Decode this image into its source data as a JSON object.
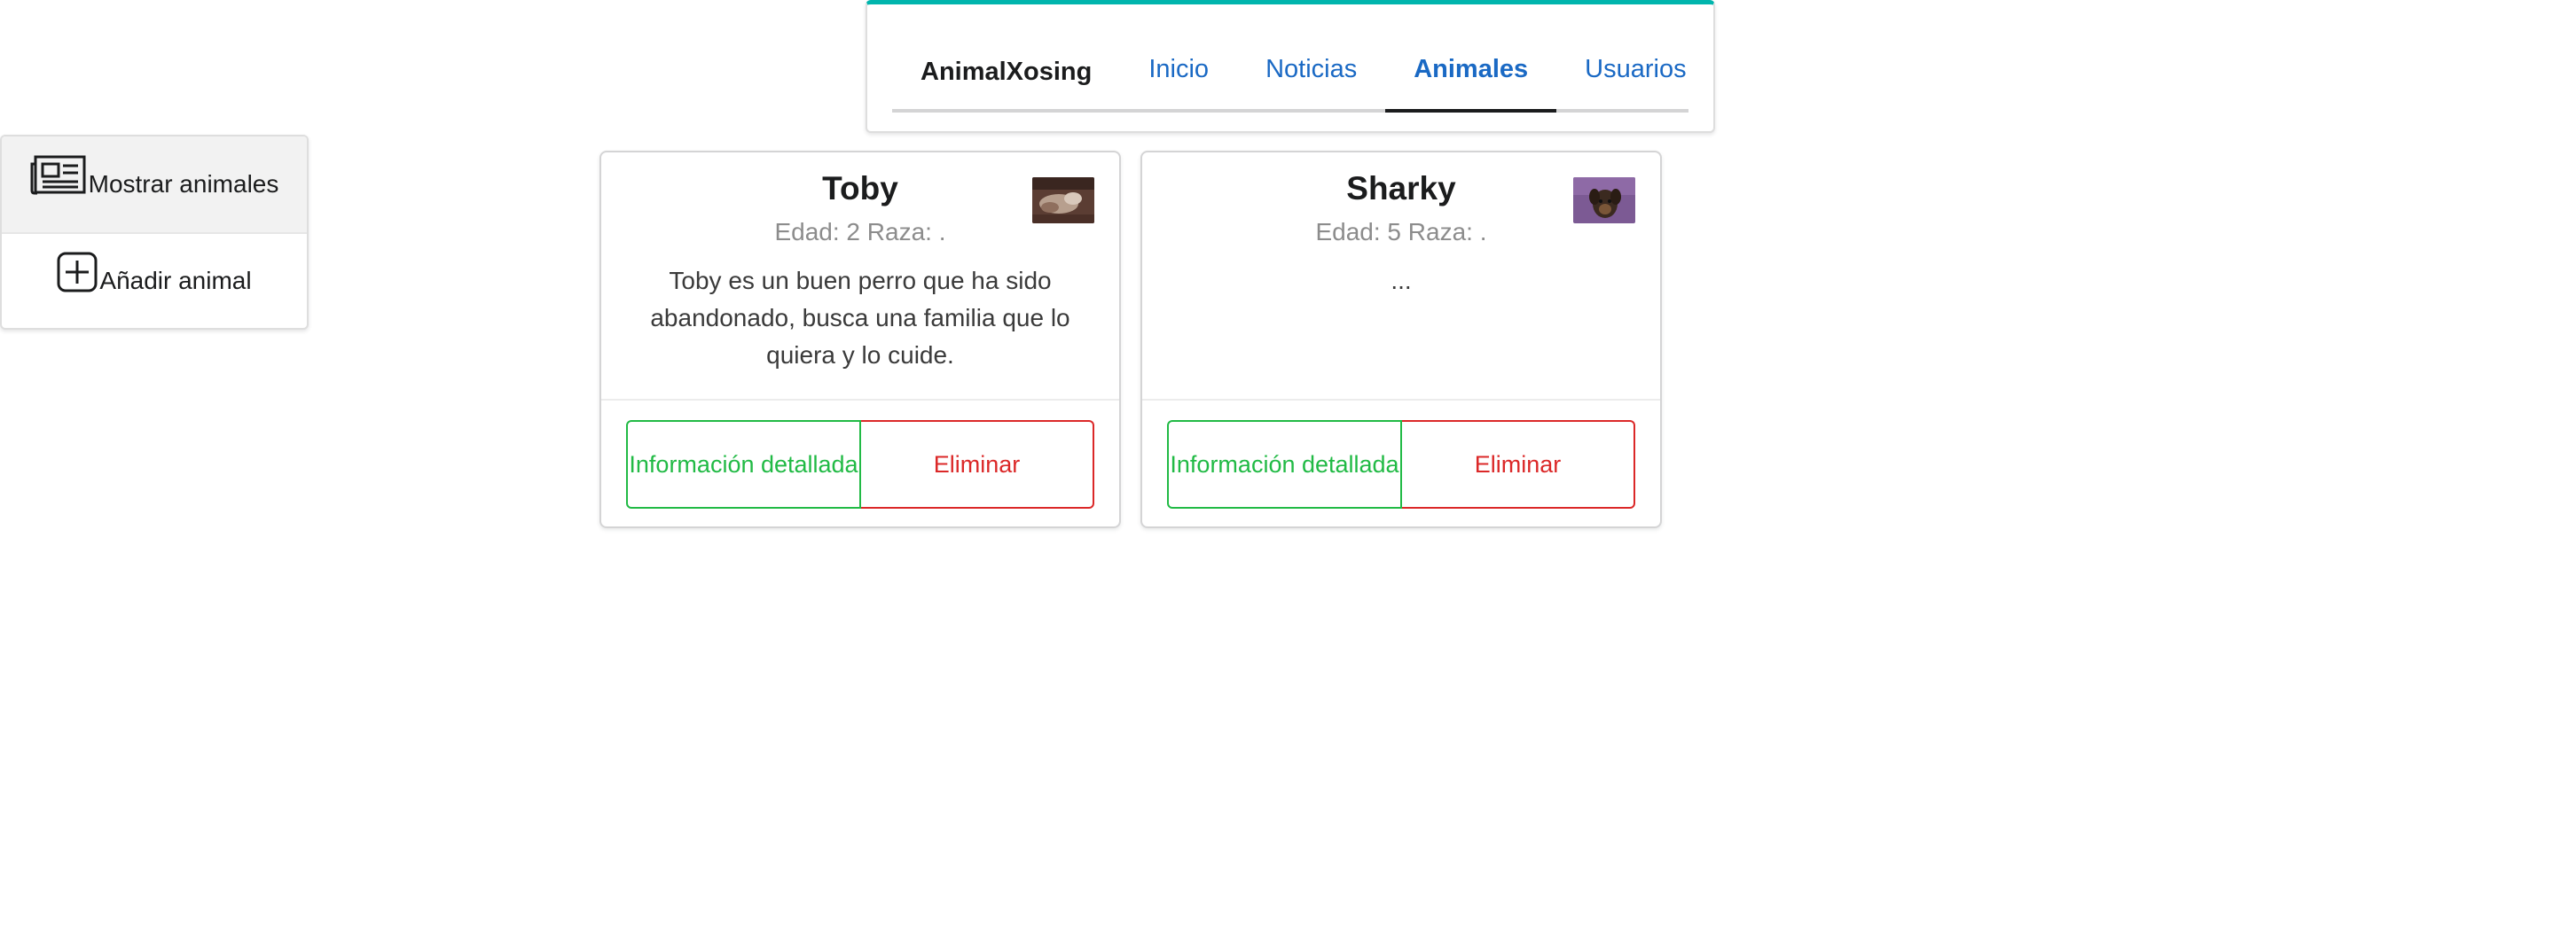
{
  "nav": {
    "brand": "AnimalXosing",
    "items": [
      {
        "label": "Inicio",
        "active": false
      },
      {
        "label": "Noticias",
        "active": false
      },
      {
        "label": "Animales",
        "active": true
      },
      {
        "label": "Usuarios",
        "active": false
      }
    ],
    "accent_color": "#00b5ad"
  },
  "sidebar": {
    "items": [
      {
        "label": "Mostrar animales",
        "icon": "newspaper-icon",
        "active": true
      },
      {
        "label": "Añadir animal",
        "icon": "plus-square-icon",
        "active": false
      }
    ]
  },
  "cards": [
    {
      "name": "Toby",
      "meta": "Edad: 2 Raza: .",
      "description": "Toby es un buen perro que ha sido abandonado, busca una familia que lo quiera y lo cuide.",
      "info_label": "Información detallada",
      "delete_label": "Eliminar"
    },
    {
      "name": "Sharky",
      "meta": "Edad: 5 Raza: .",
      "description": "...",
      "info_label": "Información detallada",
      "delete_label": "Eliminar"
    }
  ],
  "colors": {
    "link": "#1a69c4",
    "positive": "#21ba45",
    "negative": "#db2828"
  }
}
